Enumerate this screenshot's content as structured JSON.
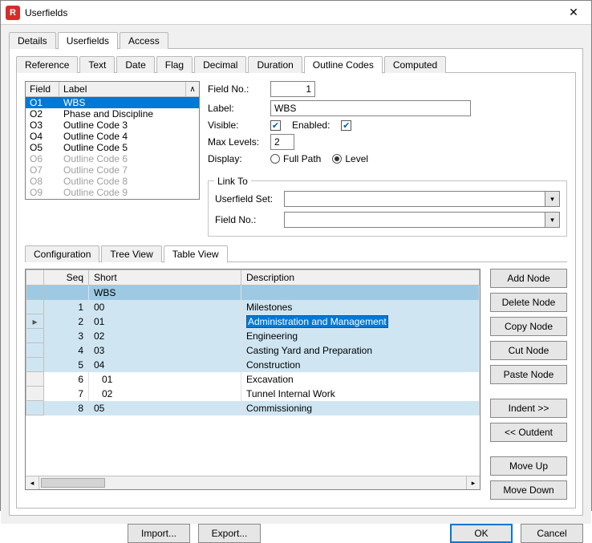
{
  "window": {
    "title": "Userfields",
    "icon_text": "R"
  },
  "tabs_top": {
    "items": [
      "Details",
      "Userfields",
      "Access"
    ],
    "active": 1
  },
  "tabs_mid": {
    "items": [
      "Reference",
      "Text",
      "Date",
      "Flag",
      "Decimal",
      "Duration",
      "Outline Codes",
      "Computed"
    ],
    "active": 6
  },
  "outline_list": {
    "headers": {
      "field": "Field",
      "label": "Label",
      "scroll_hint": "∧"
    },
    "items": [
      {
        "field": "O1",
        "label": "WBS",
        "selected": true,
        "disabled": false
      },
      {
        "field": "O2",
        "label": "Phase and Discipline",
        "selected": false,
        "disabled": false
      },
      {
        "field": "O3",
        "label": "Outline Code 3",
        "selected": false,
        "disabled": false
      },
      {
        "field": "O4",
        "label": "Outline Code 4",
        "selected": false,
        "disabled": false
      },
      {
        "field": "O5",
        "label": "Outline Code 5",
        "selected": false,
        "disabled": false
      },
      {
        "field": "O6",
        "label": "Outline Code 6",
        "selected": false,
        "disabled": true
      },
      {
        "field": "O7",
        "label": "Outline Code 7",
        "selected": false,
        "disabled": true
      },
      {
        "field": "O8",
        "label": "Outline Code 8",
        "selected": false,
        "disabled": true
      },
      {
        "field": "O9",
        "label": "Outline Code 9",
        "selected": false,
        "disabled": true
      }
    ]
  },
  "form": {
    "fieldno_label": "Field No.:",
    "fieldno_value": "1",
    "label_label": "Label:",
    "label_value": "WBS",
    "visible_label": "Visible:",
    "visible_checked": true,
    "enabled_label": "Enabled:",
    "enabled_checked": true,
    "maxlevels_label": "Max Levels:",
    "maxlevels_value": "2",
    "display_label": "Display:",
    "fullpath_label": "Full Path",
    "level_label": "Level",
    "display_value": "level",
    "linkto_title": "Link To",
    "userfieldset_label": "Userfield Set:",
    "userfieldset_value": "",
    "link_fieldno_label": "Field No.:",
    "link_fieldno_value": ""
  },
  "tabs_low": {
    "items": [
      "Configuration",
      "Tree View",
      "Table View"
    ],
    "active": 2
  },
  "table": {
    "headers": {
      "seq": "Seq",
      "short": "Short",
      "desc": "Description"
    },
    "header_row_short": "WBS",
    "rows": [
      {
        "seq": "1",
        "short": "00",
        "desc": "Milestones",
        "indent": 0,
        "lvl": 0
      },
      {
        "seq": "2",
        "short": "01",
        "desc": "Administration and Management",
        "indent": 0,
        "lvl": 0,
        "selected": true,
        "pointer": true
      },
      {
        "seq": "3",
        "short": "02",
        "desc": "Engineering",
        "indent": 0,
        "lvl": 0
      },
      {
        "seq": "4",
        "short": "03",
        "desc": "Casting Yard and Preparation",
        "indent": 0,
        "lvl": 0
      },
      {
        "seq": "5",
        "short": "04",
        "desc": "Construction",
        "indent": 0,
        "lvl": 0
      },
      {
        "seq": "6",
        "short": "01",
        "desc": "Excavation",
        "indent": 1,
        "lvl": 1
      },
      {
        "seq": "7",
        "short": "02",
        "desc": "Tunnel Internal Work",
        "indent": 1,
        "lvl": 1
      },
      {
        "seq": "8",
        "short": "05",
        "desc": "Commissioning",
        "indent": 0,
        "lvl": 0
      }
    ]
  },
  "side_buttons": {
    "add": "Add Node",
    "del": "Delete Node",
    "copy": "Copy Node",
    "cut": "Cut Node",
    "paste": "Paste Node",
    "indent": "Indent >>",
    "outdent": "<< Outdent",
    "up": "Move Up",
    "down": "Move Down"
  },
  "footer": {
    "import": "Import...",
    "export": "Export...",
    "ok": "OK",
    "cancel": "Cancel"
  }
}
